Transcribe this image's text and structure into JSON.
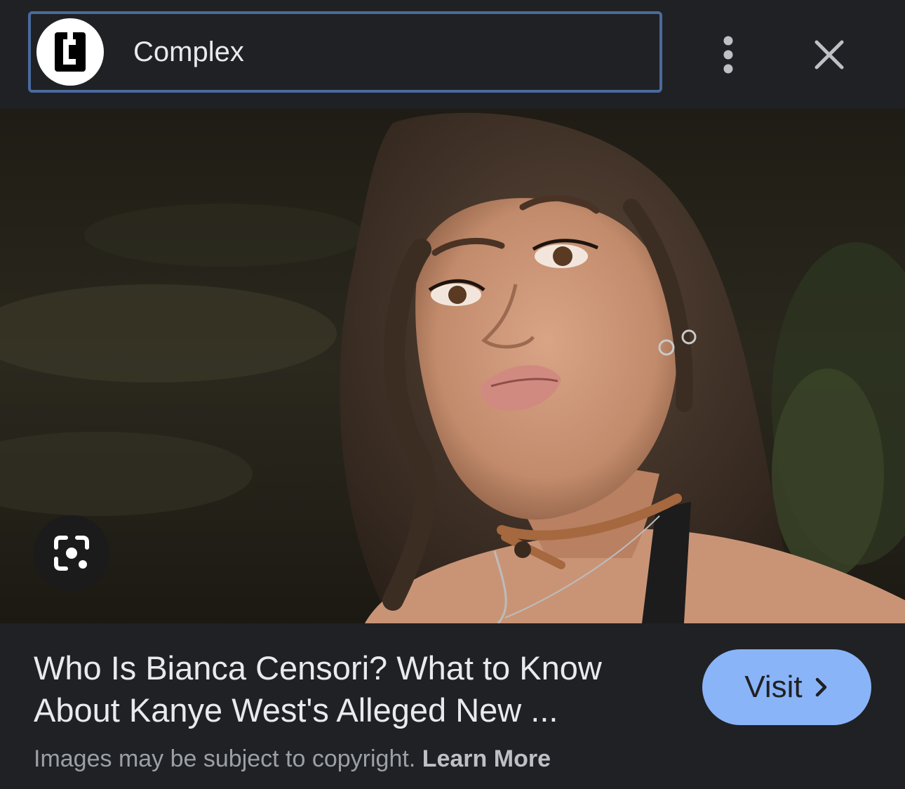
{
  "header": {
    "site_name": "Complex",
    "logo_icon": "complex-c-logo-icon",
    "more_icon": "more-vert-icon",
    "close_icon": "close-icon"
  },
  "image": {
    "lens_icon": "google-lens-icon"
  },
  "result": {
    "title_line1": "Who Is Bianca Censori? What to Know",
    "title_line2": "About Kanye West's Alleged New ...",
    "visit_label": "Visit",
    "visit_icon": "chevron-right-icon",
    "copyright_text": "Images may be subject to copyright.",
    "learn_more_label": "Learn More"
  },
  "colors": {
    "background": "#202124",
    "accent": "#8ab4f8",
    "chip_border": "#4a6a9e"
  }
}
